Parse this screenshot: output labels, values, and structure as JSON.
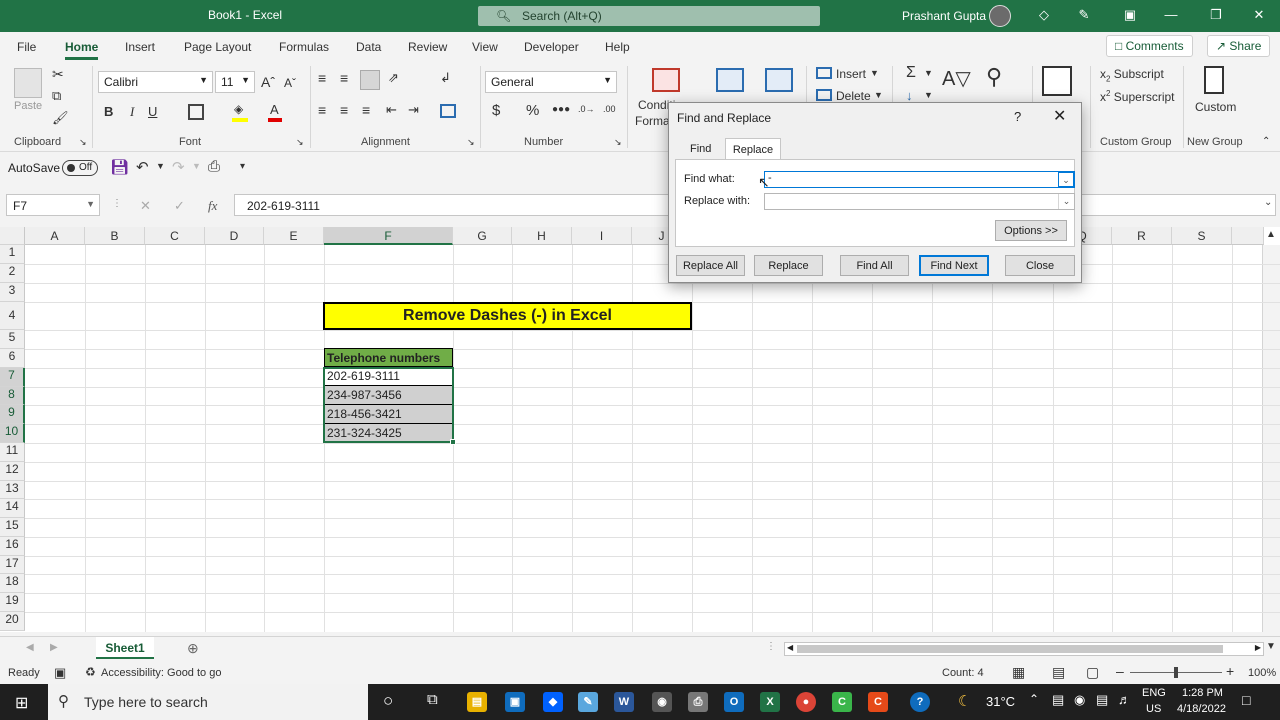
{
  "window": {
    "title": "Book1 - Excel",
    "search_placeholder": "Search (Alt+Q)",
    "user": "Prashant Gupta"
  },
  "ribbon_tabs": [
    "File",
    "Home",
    "Insert",
    "Page Layout",
    "Formulas",
    "Data",
    "Review",
    "View",
    "Developer",
    "Help"
  ],
  "active_tab": "Home",
  "ribbon_actions": {
    "comments": "Comments",
    "share": "Share"
  },
  "clipboard": {
    "paste": "Paste",
    "label": "Clipboard"
  },
  "font": {
    "name": "Calibri",
    "size": "11",
    "label": "Font",
    "bold": "B",
    "italic": "I",
    "underline": "U"
  },
  "alignment": {
    "label": "Alignment"
  },
  "number": {
    "format": "General",
    "label": "Number",
    "currency": "$",
    "percent": "%"
  },
  "styles": {
    "conditional": "Conditi",
    "format": "Format"
  },
  "cells": {
    "insert": "Insert",
    "delete": "Delete"
  },
  "custom_group": {
    "subscript": "Subscript",
    "superscript": "Superscript",
    "label": "Custom Group"
  },
  "new_group": {
    "custom": "Custom",
    "label": "New Group"
  },
  "qat": {
    "autosave": "AutoSave",
    "toggle": "Off"
  },
  "formula_bar": {
    "name_box": "F7",
    "formula": "202-619-3111"
  },
  "columns": [
    "A",
    "B",
    "C",
    "D",
    "E",
    "F",
    "G",
    "H",
    "I",
    "J",
    "Q",
    "R",
    "S"
  ],
  "rows": [
    "1",
    "2",
    "3",
    "4",
    "5",
    "6",
    "7",
    "8",
    "9",
    "10",
    "11",
    "12",
    "13",
    "14",
    "15",
    "16",
    "17",
    "18",
    "19",
    "20"
  ],
  "sheet": {
    "title_cell": "Remove Dashes (-) in Excel",
    "table_header": "Telephone numbers",
    "phones": [
      "202-619-3111",
      "234-987-3456",
      "218-456-3421",
      "231-324-3425"
    ]
  },
  "sheet_tab": "Sheet1",
  "status": {
    "ready": "Ready",
    "accessibility": "Accessibility: Good to go",
    "count": "Count: 4",
    "zoom": "100%"
  },
  "dialog": {
    "title": "Find and Replace",
    "help": "?",
    "tabs": [
      "Find",
      "Replace"
    ],
    "active_tab": "Replace",
    "find_label": "Find what:",
    "replace_label": "Replace with:",
    "find_value": "-",
    "replace_value": "",
    "options": "Options >>",
    "buttons": {
      "replace_all": "Replace All",
      "replace": "Replace",
      "find_all": "Find All",
      "find_next": "Find Next",
      "close": "Close"
    }
  },
  "taskbar": {
    "search_placeholder": "Type here to search",
    "temperature": "31°C",
    "lang": "ENG",
    "region": "US",
    "time": "1:28 PM",
    "date": "4/18/2022"
  },
  "colors": {
    "excel_green": "#217346",
    "title_fill": "#ffff00",
    "header_fill": "#70ad47",
    "accent_blue": "#0078d7"
  }
}
